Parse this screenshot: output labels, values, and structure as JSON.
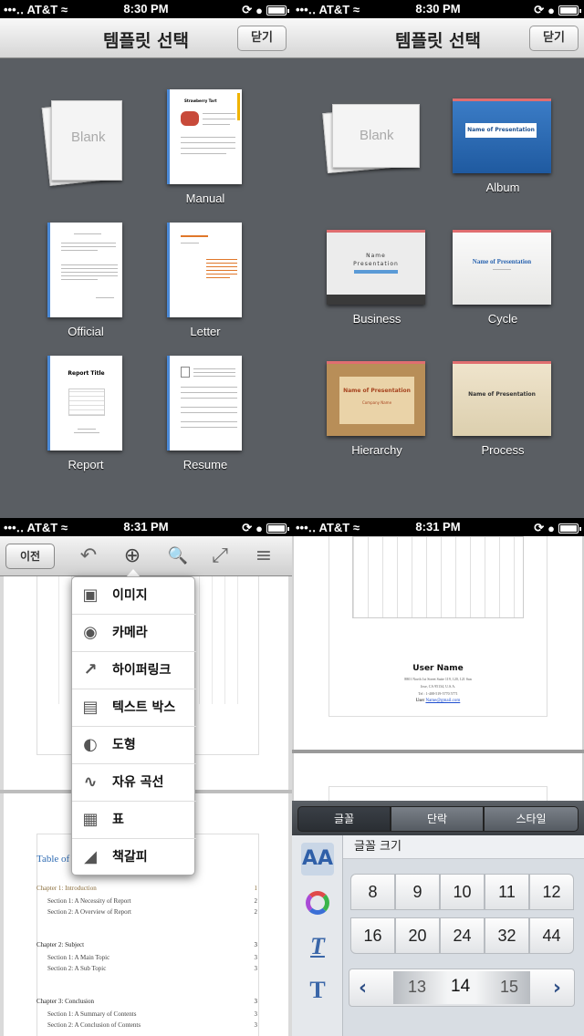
{
  "status": {
    "carrier": "AT&T",
    "signal": "•••‥",
    "time_tl": "8:30 PM",
    "time_tr": "8:30 PM",
    "time_bl": "8:31 PM",
    "time_br": "8:31 PM"
  },
  "chooser": {
    "title": "템플릿 선택",
    "close_label": "닫기"
  },
  "doc_templates": [
    {
      "label": "",
      "blank_text": "Blank"
    },
    {
      "label": "Manual",
      "thumb_title": "Strawberry Tart"
    },
    {
      "label": "Official"
    },
    {
      "label": "Letter"
    },
    {
      "label": "Report",
      "thumb_title": "Report Title"
    },
    {
      "label": "Resume"
    }
  ],
  "pres_templates": [
    {
      "label": "",
      "blank_text": "Blank"
    },
    {
      "label": "Album",
      "thumb_text": "Name of Presentation",
      "color": "#2e6bb3"
    },
    {
      "label": "Business",
      "thumb_text": "Name",
      "thumb_text2": "Presentation",
      "color": "#e8e8e8"
    },
    {
      "label": "Cycle",
      "thumb_text": "Name of Presentation",
      "color": "#f0f0ee"
    },
    {
      "label": "Hierarchy",
      "thumb_text": "Name of Presentation",
      "thumb_sub": "Company Name",
      "color": "#e7c99a"
    },
    {
      "label": "Process",
      "thumb_text": "Name of Presentation",
      "color": "#eadfc8"
    }
  ],
  "editor": {
    "back_label": "이전",
    "toc_title": "Table of",
    "toc": [
      {
        "text": "Chapter 1: Introduction",
        "page": "1"
      },
      {
        "text": "Section 1: A Necessity of Report",
        "page": "2"
      },
      {
        "text": "Section 2: A Overview of Report",
        "page": "2"
      },
      {
        "text": "Chapter 2: Subject",
        "page": "3"
      },
      {
        "text": "Section 1: A Main Topic",
        "page": "3"
      },
      {
        "text": "Section 2: A Sub Topic",
        "page": "3"
      },
      {
        "text": "Chapter 3: Conclusion",
        "page": "3"
      },
      {
        "text": "Section 1: A Summary of Contents",
        "page": "3"
      },
      {
        "text": "Section 2: A Conclusion of Contents",
        "page": "3"
      }
    ]
  },
  "insert_menu": [
    {
      "label": "이미지",
      "icon": "image-icon"
    },
    {
      "label": "카메라",
      "icon": "camera-icon"
    },
    {
      "label": "하이퍼링크",
      "icon": "hyperlink-icon"
    },
    {
      "label": "텍스트 박스",
      "icon": "textbox-icon"
    },
    {
      "label": "도형",
      "icon": "shape-icon"
    },
    {
      "label": "자유 곡선",
      "icon": "freehand-icon"
    },
    {
      "label": "표",
      "icon": "table-icon"
    },
    {
      "label": "책갈피",
      "icon": "bookmark-icon"
    }
  ],
  "report_page": {
    "user_name": "User Name",
    "address1": "8801 North 1st Street Suite 119, 120, 121 San",
    "address2": "Jose, CA 95134, U.S.A.",
    "phone": "Tel : 1-408-519-5770 5771",
    "email_label": "User",
    "email": "Name@gmail.com"
  },
  "format": {
    "tabs": [
      "글꼴",
      "단락",
      "스타일"
    ],
    "active_tab": 0,
    "header": "글꼴 크기",
    "sizes": [
      "8",
      "9",
      "10",
      "11",
      "12",
      "16",
      "20",
      "24",
      "32",
      "44"
    ],
    "stepper": {
      "prev": "13",
      "current": "14",
      "next": "15"
    }
  }
}
